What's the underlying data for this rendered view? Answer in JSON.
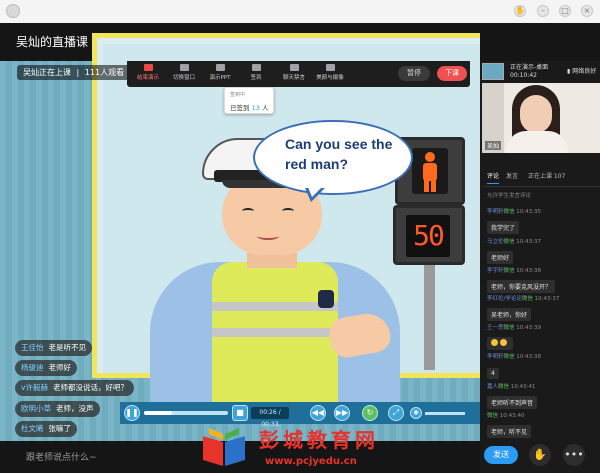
{
  "window": {
    "title": "吴灿的直播课",
    "controls": [
      "hand-icon",
      "minimize-icon",
      "maximize-icon",
      "close-icon"
    ]
  },
  "stage": {
    "live_status": "吴灿正在上课",
    "viewers": "111人观看",
    "bubble_line1": "Can you see the",
    "bubble_line2": "red man?",
    "countdown": "50"
  },
  "toolbar": {
    "items": [
      {
        "label": "结束演示",
        "icon": "stop-share-icon"
      },
      {
        "label": "切换窗口",
        "icon": "window-icon"
      },
      {
        "label": "演示PPT",
        "icon": "ppt-icon"
      },
      {
        "label": "签到",
        "icon": "checkin-icon"
      },
      {
        "label": "聊天禁言",
        "icon": "mute-icon"
      },
      {
        "label": "美颜与摄像",
        "icon": "camera-icon"
      }
    ],
    "pause": "暂停",
    "end_class": "下课"
  },
  "signin_popup": {
    "line1": "签到中",
    "line2_prefix": "已签到",
    "count": "13",
    "unit": "人"
  },
  "player": {
    "time": "00:26 / 00:33",
    "progress": 0.33
  },
  "overlay_chat": [
    {
      "name": "王佳怡",
      "text": "老是听不见"
    },
    {
      "name": "杨骏迪",
      "text": "老师好"
    },
    {
      "name": "v许毅赫",
      "text": "老师都没说话，好吧？"
    },
    {
      "name": "欧明小草",
      "text": "老师，没声"
    },
    {
      "name": "杜文晞",
      "text": "张嘛了"
    }
  ],
  "input": {
    "placeholder": "跟老师说点什么~"
  },
  "watermark": {
    "title": "彭城教育网",
    "url": "www.pcjyedu.cn"
  },
  "right_panel": {
    "share_line1": "正在演示-桌面",
    "share_line2": "00:10:42",
    "network": "网络良好",
    "cam_name": "吴灿",
    "tabs": [
      "评论",
      "发言",
      "正在上课 107"
    ],
    "allow_text": "允许学生发言评论",
    "messages": [
      {
        "name": "李明轩",
        "tag": "微信",
        "time": "10:43:35",
        "text": "我学完了"
      },
      {
        "name": "马立伦",
        "tag": "微信",
        "time": "10:43:37",
        "text": "老师好"
      },
      {
        "name": "李宇轩",
        "tag": "微信",
        "time": "10:43:38",
        "text": "老师，你要克风没开？"
      },
      {
        "name": "李红伦/学论论",
        "tag": "微信",
        "time": "10:43:37",
        "text": "吴老师，你好"
      },
      {
        "name": "王一思",
        "tag": "微信",
        "time": "10:43:39",
        "text": ""
      },
      {
        "name": "李明轩",
        "tag": "微信",
        "time": "10:43:38",
        "text": "4"
      },
      {
        "name": "嘉人",
        "tag": "微信",
        "time": "10:43:41",
        "text": "老师听不到声音"
      },
      {
        "name": "",
        "tag": "微信",
        "time": "10:43:40",
        "text": "老师，听不见"
      }
    ],
    "send": "发送"
  }
}
